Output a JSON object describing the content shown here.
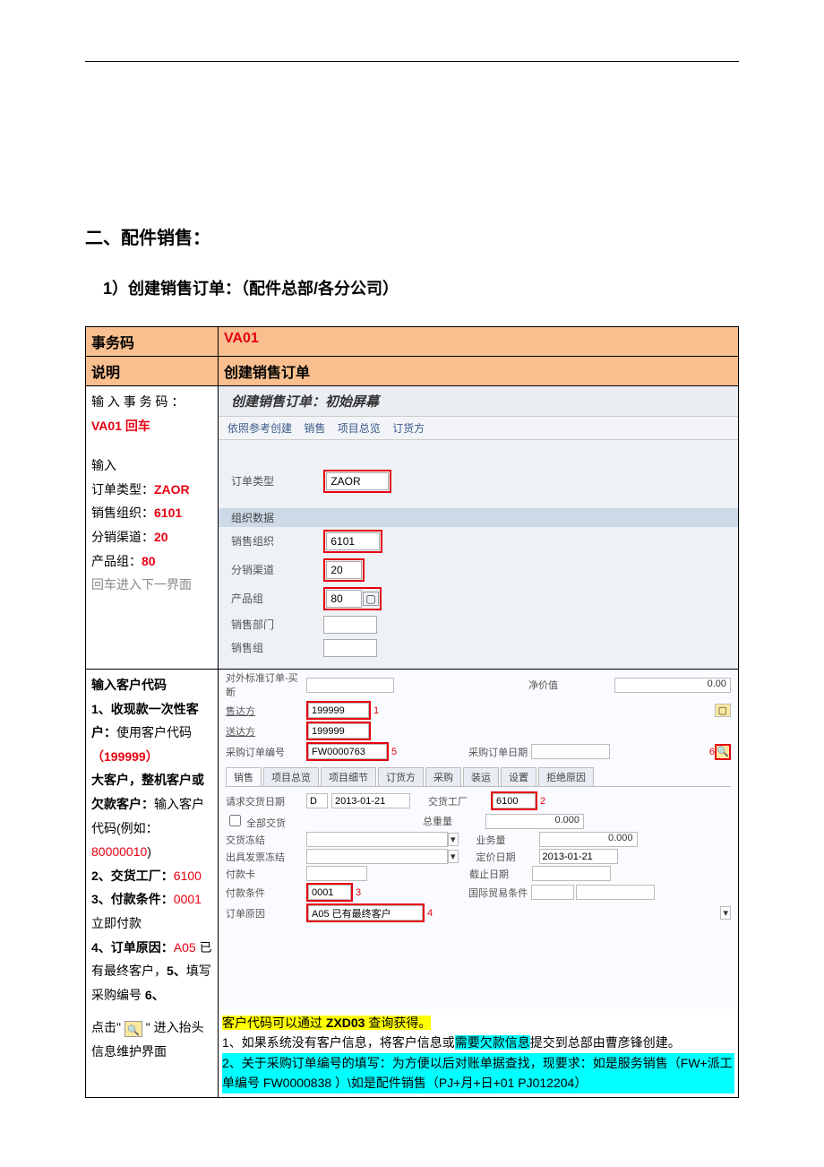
{
  "section_title": "二、配件销售：",
  "subsection_title": "1）创建销售订单：（配件总部/各分公司）",
  "table_header": {
    "col1": "事务码",
    "col2_code": "VA01"
  },
  "desc_row": {
    "label": "说明",
    "value": "创建销售订单"
  },
  "step1": {
    "left": {
      "line1a": "输 入 事 务 码 ：",
      "line1b": "VA01 回车",
      "line2": "输入",
      "line3a": "订单类型：",
      "line3b": "ZAOR",
      "line4a": "销售组织：",
      "line4b": "6101",
      "line5a": "分销渠道：",
      "line5b": "20",
      "line6a": "产品组：",
      "line6b": "80",
      "line7": "回车进入下一界面"
    },
    "sap": {
      "title": "创建销售订单：初始屏幕",
      "toolbar": {
        "a": "依照参考创建",
        "b": "销售",
        "c": "项目总览",
        "d": "订货方"
      },
      "order_type_label": "订单类型",
      "order_type": "ZAOR",
      "group_label": "组织数据",
      "sales_org_label": "销售组织",
      "sales_org": "6101",
      "dist_ch_label": "分销渠道",
      "dist_ch": "20",
      "division_label": "产品组",
      "division": "80",
      "sales_office_label": "销售部门",
      "sales_group_label": "销售组"
    }
  },
  "step2": {
    "left": {
      "t1": "输入客户代码",
      "l1a": "1、收现款一次性客户：",
      "l1b": "使用客户代码",
      "l1c": "（199999）",
      "l2a": "大客户，整机客户或欠款客户：",
      "l2b": "输入客户代码(例如：",
      "l2c": "80000010",
      "l2d": ")",
      "l3a": "2、交货工厂：",
      "l3b": "6100",
      "l4a": "3、付款条件：",
      "l4b": "0001",
      "l4c": "立即付款",
      "l5a": "4、订单原因：",
      "l5b": "A05",
      "l5c": "已有最终客户，",
      "l5d": "5、",
      "l5e": "填写采购编号",
      "l5f": "6、",
      "l6a": "点击\"",
      "l6b": "\"   进入抬头信息维护界面"
    },
    "sap": {
      "header_label": "对外标准订单-买断",
      "net_label": "净价值",
      "net_value": "0.00",
      "soldto_label": "售达方",
      "soldto": "199999",
      "shipto_label": "送达方",
      "shipto": "199999",
      "po_label": "采购订单编号",
      "po": "FW0000763",
      "po_date_label": "采购订单日期",
      "tabs": [
        "销售",
        "项目总览",
        "项目细节",
        "订货方",
        "采购",
        "装运",
        "设置",
        "拒绝原因"
      ],
      "reqdate_label": "请求交货日期",
      "reqdate_flag": "D",
      "reqdate": "2013-01-21",
      "plant_label": "交货工厂",
      "plant": "6100",
      "complete_label": "全部交货",
      "weight_label": "总重量",
      "weight": "0.000",
      "freeze_label": "交货冻结",
      "volume_label": "业务量",
      "volume": "0.000",
      "invfreeze_label": "出具发票冻结",
      "pricedate_label": "定价日期",
      "pricedate": "2013-01-21",
      "paycard_label": "付款卡",
      "duedate_label": "截止日期",
      "payterm_label": "付款条件",
      "payterm": "0001",
      "incoterm_label": "国际贸易条件",
      "reason_label": "订单原因",
      "reason": "A05 已有最终客户",
      "nums": {
        "n1": "1",
        "n2": "2",
        "n3": "3",
        "n4": "4",
        "n5": "5",
        "n6": "6"
      }
    },
    "notes": {
      "n0a": "客户代码可以通过 ",
      "n0b": "ZXD03",
      "n0c": " 查询获得。",
      "n1a": "1、如果系统没有客户信息，将客户信息或",
      "n1b": "需要欠款信息",
      "n1c": "提交到总部由曹彦锋创建。",
      "n2": "2、关于采购订单编号的填写：为方便以后对账单据查找，现要求：如是服务销售（FW+派工单编号   FW0000838 ）\\如是配件销售（PJ+月+日+01   PJ012204）"
    }
  }
}
